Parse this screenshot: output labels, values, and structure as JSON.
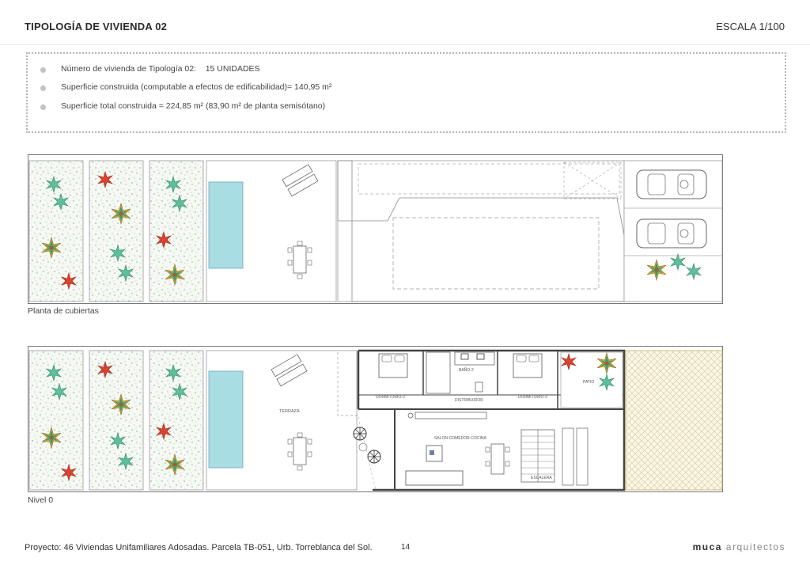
{
  "header": {
    "title": "TIPOLOGÍA DE VIVIENDA 02",
    "scale": "ESCALA 1/100"
  },
  "info": {
    "items": [
      {
        "label": "Número de vivienda de Tipología 02:",
        "value": "15 UNIDADES"
      },
      {
        "label": "Superficie construida (computable a efectos de edificabilidad)= 140,95 m²",
        "value": ""
      },
      {
        "label": "Superficie total construida = 224,85 m² (83,90 m² de planta semisótano)",
        "value": ""
      }
    ]
  },
  "plans": {
    "roof_caption": "Planta de cubiertas",
    "ground_caption": "Nivel 0",
    "rooms": {
      "dormitorio2": "DORMITORIO-2",
      "bano2": "BAÑO-2",
      "distribuidor": "DISTRIBUIDOR",
      "dormitorio3": "DORMITORIO-3",
      "patio": "PATIO",
      "terraza": "TERRAZA",
      "salon": "SALON-COMEDOR-COCINA",
      "escalera": "ESCALERA"
    }
  },
  "footer": {
    "project": "Proyecto: 46 Viviendas Unifamiliares Adosadas. Parcela TB-051, Urb. Torreblanca del Sol.",
    "page": "14",
    "brand_bold": "muca",
    "brand_light": "arquitectos"
  },
  "colors": {
    "pool": "#a9dde4",
    "plant_green": "#5fbf9a",
    "plant_red": "#d9442e",
    "plant_yellow": "#c9a640",
    "gravel_bg": "#f4f7f2",
    "hatch": "#e7dcb4"
  },
  "icons": [
    "bullet-icon",
    "car-icon",
    "palm-plant-icon",
    "bed-icon",
    "table-icon",
    "sunbed-icon",
    "spiral-stair-icon"
  ]
}
